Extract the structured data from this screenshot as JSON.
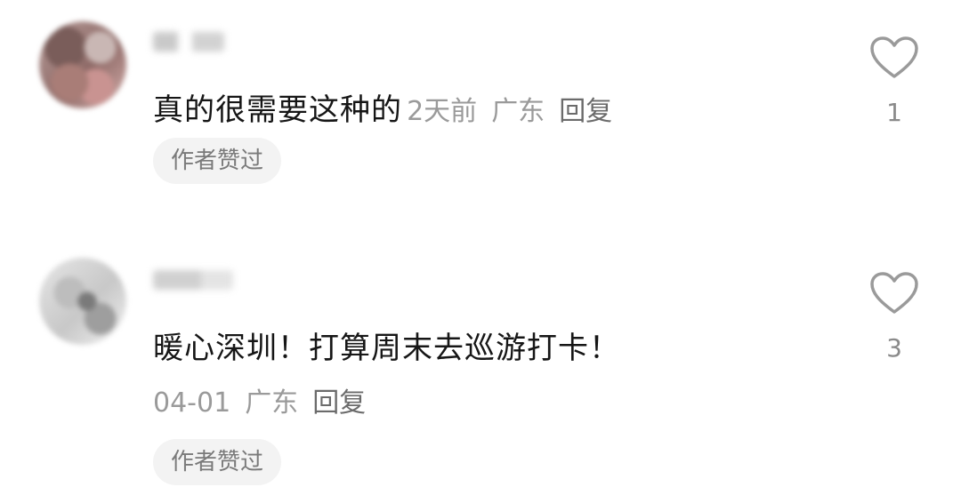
{
  "comments": [
    {
      "text": "真的很需要这种的",
      "time": "2天前",
      "location": "广东",
      "reply_label": "回复",
      "badge": "作者赞过",
      "likes": "1"
    },
    {
      "text": "暖心深圳！打算周末去巡游打卡！",
      "time": "04-01",
      "location": "广东",
      "reply_label": "回复",
      "badge": "作者赞过",
      "likes": "3"
    }
  ],
  "icons": {
    "like": "heart-outline-icon"
  },
  "colors": {
    "text_primary": "#161616",
    "text_secondary": "#9a9a9a",
    "badge_bg": "#f3f3f3"
  }
}
